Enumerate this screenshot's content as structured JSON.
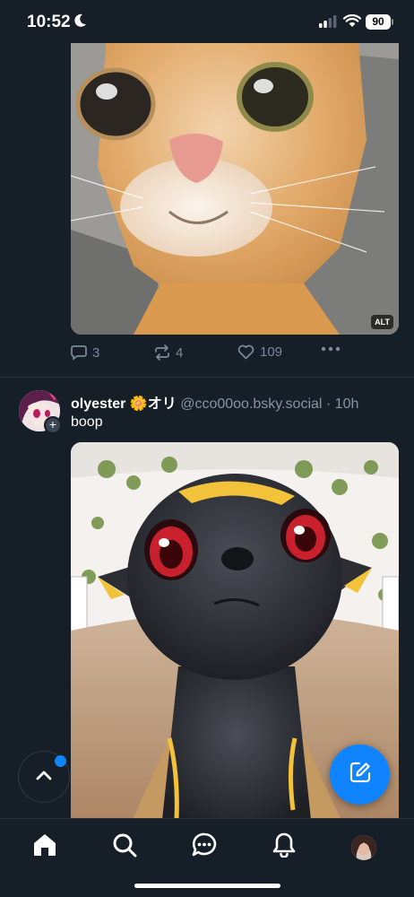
{
  "status_bar": {
    "time": "10:52",
    "battery": "90"
  },
  "post1": {
    "image_alt_badge": "ALT",
    "image_subject": "close-up orange tabby cat",
    "reply_count": "3",
    "repost_count": "4",
    "like_count": "109"
  },
  "post2": {
    "display_name": "olyester 🌼オリ",
    "handle": "@cco00oo.bsky.social",
    "separator": " · ",
    "time": "10h",
    "text": "boop",
    "image_subject": "cartoon black Umbreon looking up at camera"
  },
  "tabbar": {
    "items": [
      "home",
      "search",
      "chat",
      "notifications",
      "profile"
    ]
  },
  "colors": {
    "background": "#161e27",
    "accent": "#1083fe",
    "muted_text": "#7b8a9c",
    "handle_text": "#8494a7"
  }
}
